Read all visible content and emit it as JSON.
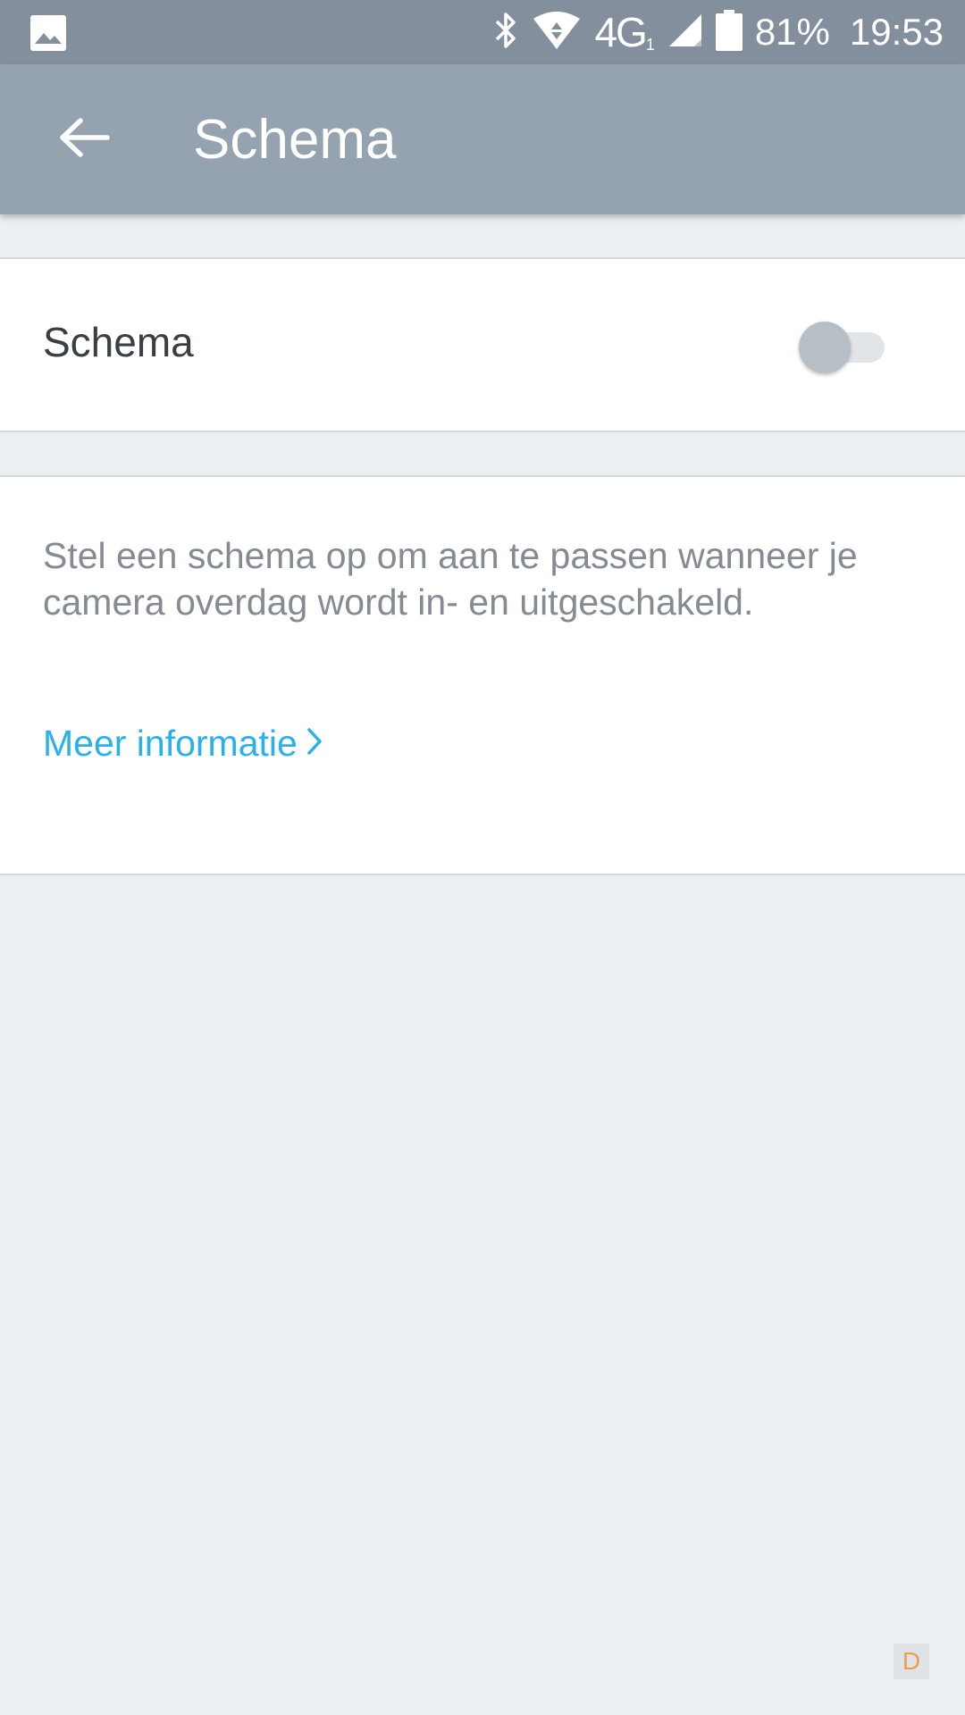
{
  "status_bar": {
    "gallery_icon": "image-icon",
    "bluetooth_icon": "bluetooth-icon",
    "wifi_icon": "wifi-icon",
    "network": "4G",
    "network_sub": "1",
    "signal_icon": "signal-icon",
    "battery_icon": "battery-icon",
    "battery": "81%",
    "time": "19:53"
  },
  "app_bar": {
    "back_icon": "arrow-left-icon",
    "title": "Schema"
  },
  "schedule_toggle": {
    "label": "Schema",
    "enabled": false
  },
  "info": {
    "description": "Stel een schema op om aan te passen wanneer je camera overdag wordt in- en uitgeschakeld.",
    "link_label": "Meer informatie",
    "link_icon": "chevron-right-icon"
  },
  "watermark": {
    "text": "D"
  },
  "colors": {
    "status_bar": "#838f9c",
    "app_bar": "#95a3b0",
    "background": "#eceff2",
    "link": "#2ab0eb"
  }
}
